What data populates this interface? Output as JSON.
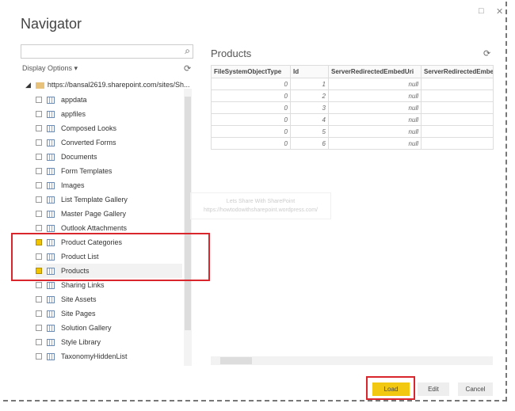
{
  "window": {
    "title": "Navigator",
    "maximize_icon": "□",
    "close_icon": "✕"
  },
  "search": {
    "placeholder": "",
    "icon": "search-icon"
  },
  "display_options": "Display Options ▾",
  "tree": {
    "root": "https://bansal2619.sharepoint.com/sites/Sh...",
    "items": [
      {
        "label": "appdata",
        "checked": false
      },
      {
        "label": "appfiles",
        "checked": false
      },
      {
        "label": "Composed Looks",
        "checked": false
      },
      {
        "label": "Converted Forms",
        "checked": false
      },
      {
        "label": "Documents",
        "checked": false
      },
      {
        "label": "Form Templates",
        "checked": false
      },
      {
        "label": "Images",
        "checked": false
      },
      {
        "label": "List Template Gallery",
        "checked": false
      },
      {
        "label": "Master Page Gallery",
        "checked": false
      },
      {
        "label": "Outlook Attachments",
        "checked": false
      },
      {
        "label": "Product Categories",
        "checked": true
      },
      {
        "label": "Product List",
        "checked": false
      },
      {
        "label": "Products",
        "checked": true
      },
      {
        "label": "Sharing Links",
        "checked": false
      },
      {
        "label": "Site Assets",
        "checked": false
      },
      {
        "label": "Site Pages",
        "checked": false
      },
      {
        "label": "Solution Gallery",
        "checked": false
      },
      {
        "label": "Style Library",
        "checked": false
      },
      {
        "label": "TaxonomyHiddenList",
        "checked": false
      }
    ]
  },
  "preview": {
    "title": "Products",
    "columns": [
      "FileSystemObjectType",
      "Id",
      "ServerRedirectedEmbedUri",
      "ServerRedirectedEmbedU"
    ],
    "rows": [
      [
        "0",
        "1",
        "null",
        ""
      ],
      [
        "0",
        "2",
        "null",
        ""
      ],
      [
        "0",
        "3",
        "null",
        ""
      ],
      [
        "0",
        "4",
        "null",
        ""
      ],
      [
        "0",
        "5",
        "null",
        ""
      ],
      [
        "0",
        "6",
        "null",
        ""
      ]
    ]
  },
  "watermark": {
    "line1": "Lets Share With SharePoint",
    "line2": "https://howtodowithsharepoint.wordpress.com/"
  },
  "buttons": {
    "load": "Load",
    "edit": "Edit",
    "cancel": "Cancel"
  },
  "colors": {
    "accent": "#f2c811",
    "highlight": "#d8262c"
  }
}
